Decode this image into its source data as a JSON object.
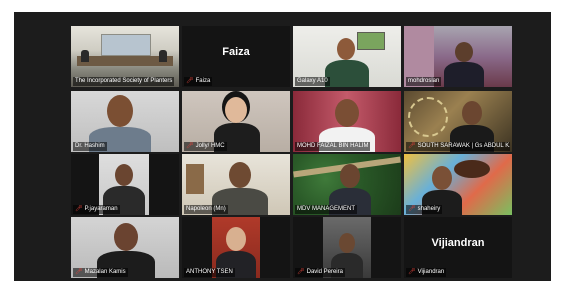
{
  "window": {
    "title": ""
  },
  "colors": {
    "active_speaker_border": "#9ed11b",
    "muted_icon": "#e0443c",
    "stage_background": "#1c1c1c",
    "name_only_tile": "#141414"
  },
  "participants": [
    {
      "name": "The Incorporated Society of Planters",
      "muted": false,
      "active": true,
      "video": true
    },
    {
      "name": "Faiza",
      "muted": true,
      "active": false,
      "video": false,
      "display_name": "Faiza"
    },
    {
      "name": "Galaxy A10",
      "muted": false,
      "active": false,
      "video": true
    },
    {
      "name": "mohdroslan",
      "muted": false,
      "active": false,
      "video": true
    },
    {
      "name": "Dr. Hashim",
      "muted": false,
      "active": false,
      "video": true
    },
    {
      "name": "Jolly/ HMC",
      "muted": true,
      "active": false,
      "video": true
    },
    {
      "name": "MOHD FAIZAL BIN HALIM",
      "muted": false,
      "active": false,
      "video": true
    },
    {
      "name": "SOUTH SARAWAK | Gs ABDUL K...",
      "muted": true,
      "active": false,
      "video": true
    },
    {
      "name": "P.jayaraman",
      "muted": true,
      "active": false,
      "video": true
    },
    {
      "name": "Napoleon (Mn)",
      "muted": false,
      "active": false,
      "video": true
    },
    {
      "name": "MDV MANAGEMENT",
      "muted": false,
      "active": false,
      "video": true
    },
    {
      "name": "shaheiry",
      "muted": true,
      "active": false,
      "video": true
    },
    {
      "name": "Mazalan Kamis",
      "muted": true,
      "active": false,
      "video": true
    },
    {
      "name": "ANTHONY TSEN",
      "muted": false,
      "active": false,
      "video": true
    },
    {
      "name": "David Pereira",
      "muted": true,
      "active": false,
      "video": true
    },
    {
      "name": "Vijiandran",
      "muted": true,
      "active": false,
      "video": false,
      "display_name": "Vijiandran"
    }
  ]
}
